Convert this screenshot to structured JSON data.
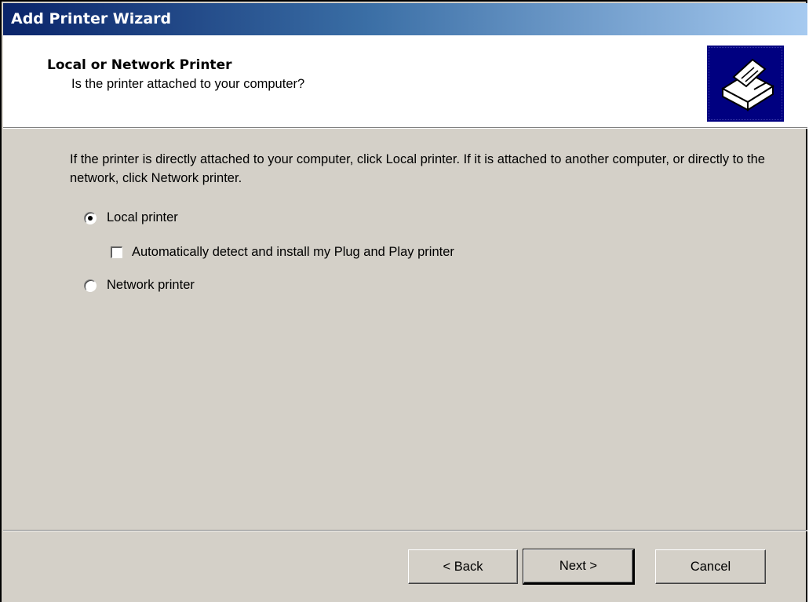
{
  "window": {
    "title": "Add Printer Wizard"
  },
  "header": {
    "title": "Local or Network Printer",
    "subtitle": "Is the printer attached to your computer?",
    "icon": "printer-icon"
  },
  "body": {
    "description": "If the printer is directly attached to your computer, click Local printer.  If it is attached to another computer, or directly to the network, click Network printer.",
    "options": [
      {
        "label": "Local printer",
        "selected": true
      },
      {
        "label": "Network printer",
        "selected": false
      }
    ],
    "auto_detect": {
      "label": "Automatically detect and install my Plug and Play printer",
      "checked": false
    }
  },
  "buttons": {
    "back": "< Back",
    "next": "Next >",
    "cancel": "Cancel"
  },
  "colors": {
    "titlebar_start": "#0a246a",
    "titlebar_end": "#a6caf0",
    "face": "#d4d0c8",
    "icon_bg": "#000080"
  }
}
